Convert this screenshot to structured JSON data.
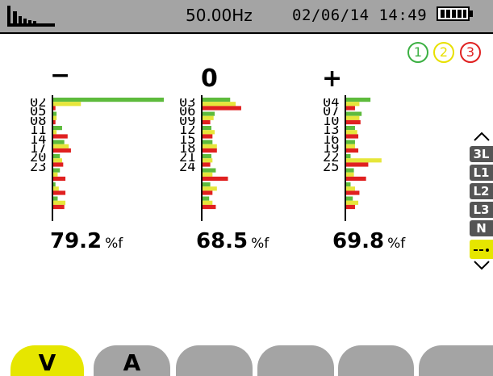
{
  "topbar": {
    "mode_icon": "harmonics-bars-icon",
    "frequency": "50.00Hz",
    "datetime": "02/06/14 14:49",
    "battery_icon": "battery-icon"
  },
  "phases": [
    {
      "label": "1",
      "color": "#3cb043"
    },
    {
      "label": "2",
      "color": "#e8e000"
    },
    {
      "label": "3",
      "color": "#e02020"
    }
  ],
  "colors": {
    "green": "#5dbb3c",
    "yellow": "#e6e63a",
    "red": "#e02020",
    "topbar": "#a4a4a4",
    "side_button": "#555555",
    "side_active": "#e6e600"
  },
  "columns": [
    {
      "header": "−",
      "ranks": [
        "02",
        "05",
        "08",
        "11",
        "14",
        "17",
        "20",
        "23"
      ],
      "value": "79.2",
      "unit": "%f",
      "bars": [
        [
          100,
          25,
          2
        ],
        [
          3,
          3,
          2
        ],
        [
          8,
          3,
          13
        ],
        [
          10,
          14,
          16
        ],
        [
          6,
          8,
          9
        ],
        [
          6,
          4,
          11
        ],
        [
          2,
          5,
          11
        ],
        [
          4,
          11,
          10
        ]
      ]
    },
    {
      "header": "0",
      "ranks": [
        "03",
        "06",
        "09",
        "12",
        "15",
        "18",
        "21",
        "24"
      ],
      "value": "68.5",
      "unit": "%f",
      "bars": [
        [
          25,
          30,
          35
        ],
        [
          11,
          10,
          7
        ],
        [
          8,
          11,
          9
        ],
        [
          9,
          13,
          13
        ],
        [
          8,
          9,
          7
        ],
        [
          12,
          9,
          23
        ],
        [
          7,
          13,
          9
        ],
        [
          6,
          9,
          12
        ]
      ]
    },
    {
      "header": "+",
      "ranks": [
        "04",
        "07",
        "10",
        "13",
        "16",
        "19",
        "22",
        "25"
      ],
      "value": "69.8",
      "unit": "%f",
      "bars": [
        [
          22,
          12,
          8
        ],
        [
          14,
          12,
          13
        ],
        [
          8,
          10,
          11
        ],
        [
          8,
          8,
          11
        ],
        [
          4,
          32,
          20
        ],
        [
          7,
          7,
          18
        ],
        [
          4,
          8,
          12
        ],
        [
          6,
          11,
          8
        ]
      ]
    }
  ],
  "chart_data": [
    {
      "type": "bar",
      "title": "−",
      "categories": [
        "02",
        "05",
        "08",
        "11",
        "14",
        "17",
        "20",
        "23"
      ],
      "series": [
        {
          "values": [
            100,
            3,
            8,
            10,
            6,
            6,
            2,
            4
          ]
        },
        {
          "values": [
            25,
            3,
            3,
            14,
            8,
            4,
            5,
            11
          ]
        },
        {
          "values": [
            2,
            2,
            13,
            16,
            9,
            11,
            11,
            10
          ]
        }
      ]
    },
    {
      "type": "bar",
      "title": "0",
      "categories": [
        "03",
        "06",
        "09",
        "12",
        "15",
        "18",
        "21",
        "24"
      ],
      "series": [
        {
          "values": [
            25,
            11,
            8,
            9,
            8,
            12,
            7,
            6
          ]
        },
        {
          "values": [
            30,
            10,
            11,
            13,
            9,
            9,
            13,
            9
          ]
        },
        {
          "values": [
            35,
            7,
            9,
            13,
            7,
            23,
            9,
            12
          ]
        }
      ]
    },
    {
      "type": "bar",
      "title": "+",
      "categories": [
        "04",
        "07",
        "10",
        "13",
        "16",
        "19",
        "22",
        "25"
      ],
      "series": [
        {
          "values": [
            22,
            14,
            8,
            8,
            4,
            7,
            4,
            6
          ]
        },
        {
          "values": [
            12,
            12,
            10,
            8,
            32,
            7,
            8,
            11
          ]
        },
        {
          "values": [
            8,
            13,
            11,
            11,
            20,
            18,
            12,
            8
          ]
        }
      ]
    }
  ],
  "side": {
    "up_icon": "chevron-up-icon",
    "down_icon": "chevron-down-icon",
    "buttons": [
      "3L",
      "L1",
      "L2",
      "L3",
      "N"
    ],
    "active_icon": "dash-dot-icon"
  },
  "tabs": [
    {
      "label": "V",
      "active": true
    },
    {
      "label": "A",
      "active": false
    },
    {
      "label": "",
      "active": false
    },
    {
      "label": "",
      "active": false
    },
    {
      "label": "",
      "active": false
    },
    {
      "label": "",
      "active": false
    }
  ]
}
